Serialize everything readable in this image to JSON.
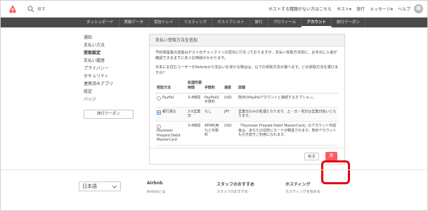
{
  "topbar": {
    "search_text": "探す",
    "nav": [
      "ホストする種類がない方はこちら",
      "ホスト▾",
      "旅行",
      "メッセージ▾",
      "ヘルプ"
    ]
  },
  "darknav": {
    "items": [
      "ダッシュボード",
      "実績データ",
      "受信トレイ",
      "リスティング",
      "ホストアシスト",
      "旅行",
      "プロフィール",
      "アカウント",
      "旅行クーポン"
    ],
    "active_index": 7
  },
  "sidebar": {
    "items": [
      "通知",
      "支払い方法",
      "受取設定",
      "支払い履歴",
      "プライバシー",
      "セキュリティ",
      "連携済みアプリ",
      "設定",
      "バッジ"
    ],
    "active_index": 2,
    "coupon_button": "旅行クーポン"
  },
  "modal": {
    "title": "支払い受取方法を追加",
    "intro": "予約保留金の送金はゲストのチェックインの翌日に行なっておりますが、支払い受取方法別に、お手元に入金が確認できるまでに多少お時間がかかります。",
    "question": "日本にお住むユーザーがAirbnbから支払いを受ける場合は、以下の受取方法が選べます。どの受取方法を選びますか？",
    "headers": [
      "受取方法",
      "処理所要時間",
      "手数料",
      "通貨",
      "詳細"
    ],
    "rows": [
      {
        "method": "PayPal",
        "time": "3-4時間",
        "fee": "PayPalの手数料",
        "currency": "USD",
        "details": "既存のPayPalアカウントと接続するオプション。",
        "selected": false
      },
      {
        "method": "銀行振込",
        "time": "3-5営業日",
        "fee": "なし",
        "currency": "JPY",
        "details": "営業日のみの処理となります。土・日・祝日は営業日扱いとなります。",
        "selected": true
      },
      {
        "method": "Payoneer Prepaid Debit MasterCard",
        "time": "3-4時間",
        "fee": "ATM利用など手数料",
        "currency": "USD",
        "details": "「Payoneer Prepaid Debit MasterCard」のアカウント作成後は、あなたの住所にカードが郵送されます。既存アカウントも引き続きご利用になれます。",
        "selected": false
      }
    ],
    "cancel_label": "戻る",
    "next_label": "次"
  },
  "footer": {
    "language": "日本語",
    "columns": [
      {
        "title": "Airbnb",
        "sub": "Airbnbとは"
      },
      {
        "title": "スタッフのおすすめ",
        "sub": "スタッフのおすすめ"
      },
      {
        "title": "ホスティング",
        "sub": "ホスティングを始める"
      }
    ]
  },
  "colors": {
    "brand": "#FF5A5F",
    "highlight": "#E3000F",
    "darknav": "#4A4A4A"
  }
}
